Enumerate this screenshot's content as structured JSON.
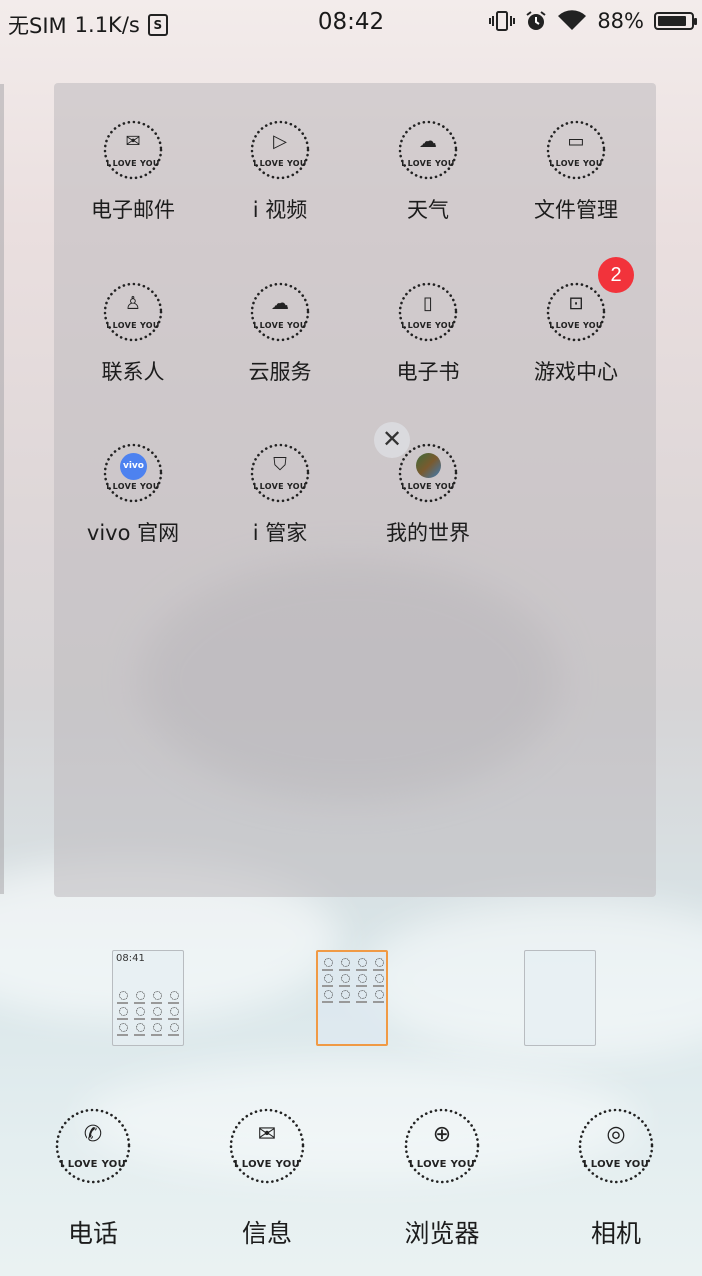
{
  "status_bar": {
    "carrier": "无SIM",
    "speed": "1.1K/s",
    "s_icon_text": "S",
    "time": "08:42",
    "battery": "88%",
    "battery_level": 0.88
  },
  "ring_text": "I LOVE YOU",
  "folder_apps": [
    {
      "label": "电子邮件",
      "icon": "mail-icon",
      "glyph": "✉"
    },
    {
      "label": "i 视频",
      "icon": "video-icon",
      "glyph": "▷"
    },
    {
      "label": "天气",
      "icon": "weather-icon",
      "glyph": "☁"
    },
    {
      "label": "文件管理",
      "icon": "folder-icon",
      "glyph": "▭"
    },
    {
      "label": "联系人",
      "icon": "contacts-icon",
      "glyph": "♙"
    },
    {
      "label": "云服务",
      "icon": "cloud-icon",
      "glyph": "☁"
    },
    {
      "label": "电子书",
      "icon": "book-icon",
      "glyph": "▯"
    },
    {
      "label": "游戏中心",
      "icon": "gamepad-icon",
      "glyph": "⊡",
      "badge": "2"
    },
    {
      "label": "vivo 官网",
      "icon": "vivo-icon",
      "glyph": "vivo"
    },
    {
      "label": "i 管家",
      "icon": "shield-icon",
      "glyph": "⛉"
    },
    {
      "label": "我的世界",
      "icon": "minecraft-icon",
      "glyph": ""
    }
  ],
  "close_glyph": "✕",
  "pages": {
    "count": 3,
    "active": 1,
    "thumb_time": "08:41"
  },
  "dock": [
    {
      "label": "电话",
      "icon": "phone-icon",
      "glyph": "✆"
    },
    {
      "label": "信息",
      "icon": "message-icon",
      "glyph": "✉"
    },
    {
      "label": "浏览器",
      "icon": "browser-icon",
      "glyph": "⊕"
    },
    {
      "label": "相机",
      "icon": "camera-icon",
      "glyph": "◎"
    }
  ]
}
